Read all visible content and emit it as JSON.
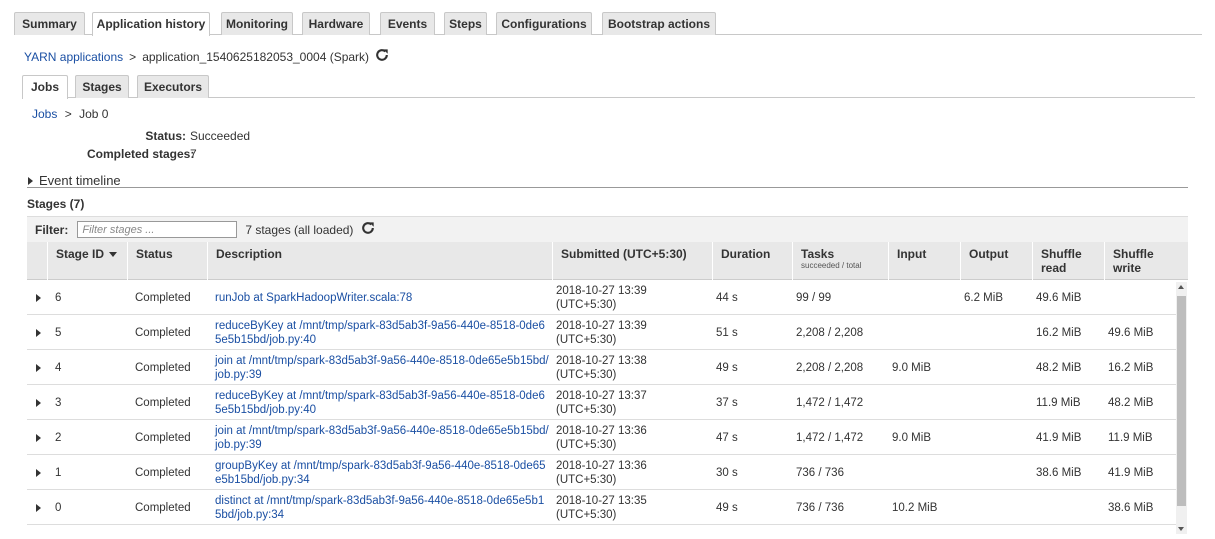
{
  "top_tabs": [
    "Summary",
    "Application history",
    "Monitoring",
    "Hardware",
    "Events",
    "Steps",
    "Configurations",
    "Bootstrap actions"
  ],
  "breadcrumb": {
    "root": "YARN applications",
    "separator": ">",
    "current": "application_1540625182053_0004 (Spark)"
  },
  "sub_tabs": [
    "Jobs",
    "Stages",
    "Executors"
  ],
  "job_breadcrumb": {
    "root": "Jobs",
    "separator": ">",
    "current": "Job 0"
  },
  "job_info": {
    "status_label": "Status:",
    "status_value": "Succeeded",
    "completed_label": "Completed stages:",
    "completed_value": "7"
  },
  "event_timeline_label": "Event timeline",
  "stages_title": "Stages (7)",
  "filter": {
    "label": "Filter:",
    "placeholder": "Filter stages ...",
    "status": "7 stages (all loaded)"
  },
  "columns": {
    "stage_id": "Stage ID",
    "status": "Status",
    "description": "Description",
    "submitted": "Submitted (UTC+5:30)",
    "duration": "Duration",
    "tasks": "Tasks",
    "tasks_sub": "succeeded / total",
    "input": "Input",
    "output": "Output",
    "shuffle_read": "Shuffle read",
    "shuffle_write": "Shuffle write"
  },
  "stages": [
    {
      "id": "6",
      "status": "Completed",
      "description": "runJob at SparkHadoopWriter.scala:78",
      "submitted_date": "2018-10-27 13:39",
      "submitted_tz": "(UTC+5:30)",
      "duration": "44 s",
      "tasks": "99 / 99",
      "input": "",
      "output": "6.2 MiB",
      "shuffle_read": "49.6 MiB",
      "shuffle_write": ""
    },
    {
      "id": "5",
      "status": "Completed",
      "description": "reduceByKey at /mnt/tmp/spark-83d5ab3f-9a56-440e-8518-0de65e5b15bd/job.py:40",
      "submitted_date": "2018-10-27 13:39",
      "submitted_tz": "(UTC+5:30)",
      "duration": "51 s",
      "tasks": "2,208 / 2,208",
      "input": "",
      "output": "",
      "shuffle_read": "16.2 MiB",
      "shuffle_write": "49.6 MiB"
    },
    {
      "id": "4",
      "status": "Completed",
      "description": "join at /mnt/tmp/spark-83d5ab3f-9a56-440e-8518-0de65e5b15bd/job.py:39",
      "submitted_date": "2018-10-27 13:38",
      "submitted_tz": "(UTC+5:30)",
      "duration": "49 s",
      "tasks": "2,208 / 2,208",
      "input": "9.0 MiB",
      "output": "",
      "shuffle_read": "48.2 MiB",
      "shuffle_write": "16.2 MiB"
    },
    {
      "id": "3",
      "status": "Completed",
      "description": "reduceByKey at /mnt/tmp/spark-83d5ab3f-9a56-440e-8518-0de65e5b15bd/job.py:40",
      "submitted_date": "2018-10-27 13:37",
      "submitted_tz": "(UTC+5:30)",
      "duration": "37 s",
      "tasks": "1,472 / 1,472",
      "input": "",
      "output": "",
      "shuffle_read": "11.9 MiB",
      "shuffle_write": "48.2 MiB"
    },
    {
      "id": "2",
      "status": "Completed",
      "description": "join at /mnt/tmp/spark-83d5ab3f-9a56-440e-8518-0de65e5b15bd/job.py:39",
      "submitted_date": "2018-10-27 13:36",
      "submitted_tz": "(UTC+5:30)",
      "duration": "47 s",
      "tasks": "1,472 / 1,472",
      "input": "9.0 MiB",
      "output": "",
      "shuffle_read": "41.9 MiB",
      "shuffle_write": "11.9 MiB"
    },
    {
      "id": "1",
      "status": "Completed",
      "description": "groupByKey at /mnt/tmp/spark-83d5ab3f-9a56-440e-8518-0de65e5b15bd/job.py:34",
      "submitted_date": "2018-10-27 13:36",
      "submitted_tz": "(UTC+5:30)",
      "duration": "30 s",
      "tasks": "736 / 736",
      "input": "",
      "output": "",
      "shuffle_read": "38.6 MiB",
      "shuffle_write": "41.9 MiB"
    },
    {
      "id": "0",
      "status": "Completed",
      "description": "distinct at /mnt/tmp/spark-83d5ab3f-9a56-440e-8518-0de65e5b15bd/job.py:34",
      "submitted_date": "2018-10-27 13:35",
      "submitted_tz": "(UTC+5:30)",
      "duration": "49 s",
      "tasks": "736 / 736",
      "input": "10.2 MiB",
      "output": "",
      "shuffle_read": "",
      "shuffle_write": "38.6 MiB"
    }
  ]
}
